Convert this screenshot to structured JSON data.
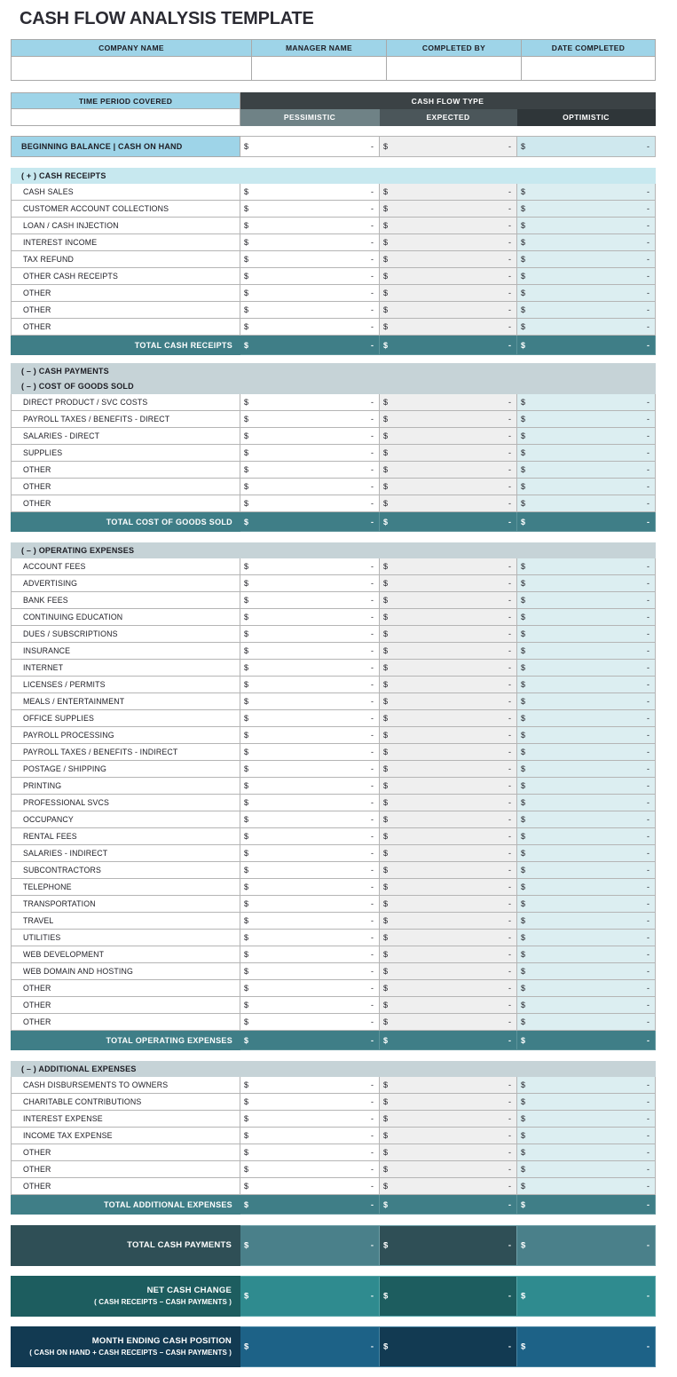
{
  "title": "CASH FLOW ANALYSIS TEMPLATE",
  "currency_symbol": "$",
  "empty_value": "-",
  "info_header": {
    "company_name": "COMPANY NAME",
    "manager_name": "MANAGER NAME",
    "completed_by": "COMPLETED BY",
    "date_completed": "DATE COMPLETED",
    "company_name_value": "",
    "manager_name_value": "",
    "completed_by_value": "",
    "date_completed_value": ""
  },
  "time_period": {
    "label": "TIME PERIOD COVERED",
    "value": "",
    "cash_flow_type": "CASH FLOW TYPE",
    "columns": [
      "PESSIMISTIC",
      "EXPECTED",
      "OPTIMISTIC"
    ]
  },
  "beginning_balance": {
    "label": "BEGINNING BALANCE | CASH ON HAND",
    "pessimistic": "-",
    "expected": "-",
    "optimistic": "-"
  },
  "sections": [
    {
      "heading": "( + )  CASH RECEIPTS",
      "rows": [
        "CASH SALES",
        "CUSTOMER ACCOUNT COLLECTIONS",
        "LOAN / CASH INJECTION",
        "INTEREST INCOME",
        "TAX REFUND",
        "OTHER CASH RECEIPTS",
        "OTHER",
        "OTHER",
        "OTHER"
      ],
      "total_label": "TOTAL CASH RECEIPTS",
      "total": {
        "pessimistic": "-",
        "expected": "-",
        "optimistic": "-"
      }
    },
    {
      "heading": "( – )  CASH PAYMENTS",
      "subheading": "( – )  COST OF GOODS SOLD",
      "rows": [
        "DIRECT PRODUCT / SVC COSTS",
        "PAYROLL TAXES / BENEFITS - DIRECT",
        "SALARIES - DIRECT",
        "SUPPLIES",
        "OTHER",
        "OTHER",
        "OTHER"
      ],
      "total_label": "TOTAL COST OF GOODS SOLD",
      "total": {
        "pessimistic": "-",
        "expected": "-",
        "optimistic": "-"
      }
    },
    {
      "heading": "( – )  OPERATING EXPENSES",
      "rows": [
        "ACCOUNT FEES",
        "ADVERTISING",
        "BANK FEES",
        "CONTINUING EDUCATION",
        "DUES / SUBSCRIPTIONS",
        "INSURANCE",
        "INTERNET",
        "LICENSES / PERMITS",
        "MEALS / ENTERTAINMENT",
        "OFFICE SUPPLIES",
        "PAYROLL PROCESSING",
        "PAYROLL TAXES / BENEFITS - INDIRECT",
        "POSTAGE / SHIPPING",
        "PRINTING",
        "PROFESSIONAL SVCS",
        "OCCUPANCY",
        "RENTAL FEES",
        "SALARIES - INDIRECT",
        "SUBCONTRACTORS",
        "TELEPHONE",
        "TRANSPORTATION",
        "TRAVEL",
        "UTILITIES",
        "WEB DEVELOPMENT",
        "WEB DOMAIN AND HOSTING",
        "OTHER",
        "OTHER",
        "OTHER"
      ],
      "total_label": "TOTAL OPERATING EXPENSES",
      "total": {
        "pessimistic": "-",
        "expected": "-",
        "optimistic": "-"
      }
    },
    {
      "heading": "( – )  ADDITIONAL EXPENSES",
      "rows": [
        "CASH DISBURSEMENTS TO OWNERS",
        "CHARITABLE CONTRIBUTIONS",
        "INTEREST EXPENSE",
        "INCOME TAX EXPENSE",
        "OTHER",
        "OTHER",
        "OTHER"
      ],
      "total_label": "TOTAL ADDITIONAL EXPENSES",
      "total": {
        "pessimistic": "-",
        "expected": "-",
        "optimistic": "-"
      }
    }
  ],
  "summary": [
    {
      "label": "TOTAL CASH PAYMENTS",
      "sublabel": "",
      "pessimistic": "-",
      "expected": "-",
      "optimistic": "-"
    },
    {
      "label": "NET CASH CHANGE",
      "sublabel": "( CASH RECEIPTS – CASH PAYMENTS )",
      "pessimistic": "-",
      "expected": "-",
      "optimistic": "-"
    },
    {
      "label": "MONTH ENDING CASH POSITION",
      "sublabel": "( CASH ON HAND + CASH RECEIPTS – CASH PAYMENTS )",
      "pessimistic": "-",
      "expected": "-",
      "optimistic": "-"
    }
  ],
  "colors": {
    "header_blue": "#9ed4e8",
    "section_cyan": "#c7e8ef",
    "section_gray": "#c6d3d7",
    "total_teal": "#3f7e87",
    "dark_slate": "#3b4245",
    "optimistic_tint": "#dceef1",
    "expected_tint": "#efefef"
  }
}
